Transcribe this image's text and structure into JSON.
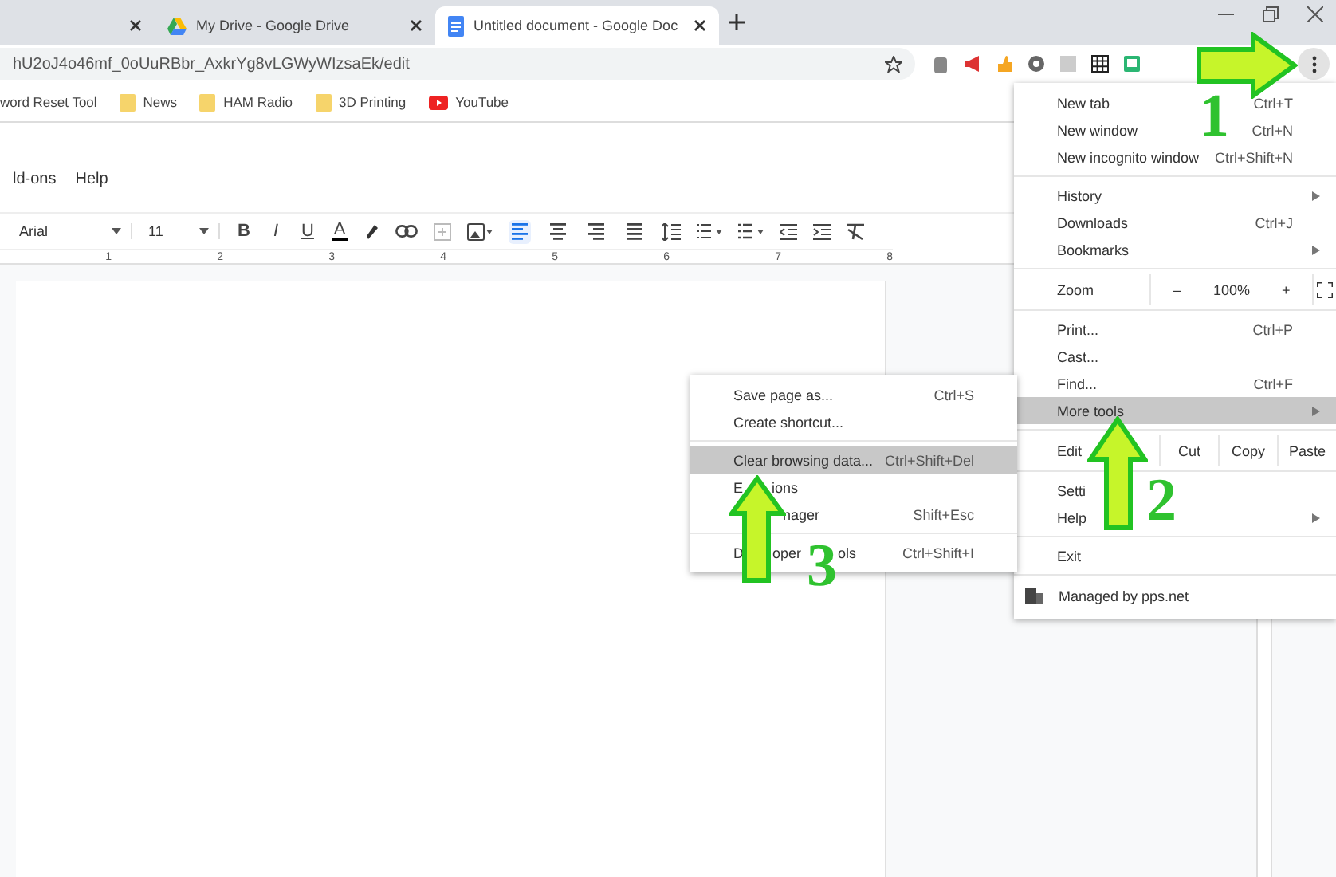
{
  "tabs": [
    {
      "selected": false
    },
    {
      "title": "My Drive - Google Drive",
      "selected": false
    },
    {
      "title": "Untitled document - Google Doc",
      "selected": true
    }
  ],
  "address": "hU2oJ4o46mf_0oUuRBbr_AxkrYg8vLGWyWIzsaEk/edit",
  "bookmarks": [
    {
      "label": "word Reset Tool",
      "kind": "plain"
    },
    {
      "label": "News",
      "kind": "folder"
    },
    {
      "label": "HAM Radio",
      "kind": "folder"
    },
    {
      "label": "3D Printing",
      "kind": "folder"
    },
    {
      "label": "YouTube",
      "kind": "video"
    }
  ],
  "docs_menu": [
    "ld-ons",
    "Help"
  ],
  "toolbar": {
    "font": "Arial",
    "size": "11",
    "format": [
      "B",
      "I",
      "U",
      "A"
    ],
    "alignment": [
      {
        "selected": true
      },
      {
        "selected": false
      },
      {
        "selected": false
      },
      {
        "selected": false
      }
    ]
  },
  "ruler": [
    "1",
    "2",
    "3",
    "4",
    "5",
    "6",
    "7",
    "8"
  ],
  "menu": [
    {
      "kind": "item",
      "label": "New tab",
      "shortcut": "Ctrl+T",
      "submenu": false,
      "selected": false
    },
    {
      "kind": "item",
      "label": "New window",
      "shortcut": "Ctrl+N",
      "submenu": false,
      "selected": false
    },
    {
      "kind": "item",
      "label": "New incognito window",
      "shortcut": "Ctrl+Shift+N",
      "submenu": false,
      "selected": false
    },
    {
      "kind": "divider"
    },
    {
      "kind": "item",
      "label": "History",
      "submenu": true,
      "selected": false
    },
    {
      "kind": "item",
      "label": "Downloads",
      "shortcut": "Ctrl+J",
      "submenu": false,
      "selected": false
    },
    {
      "kind": "item",
      "label": "Bookmarks",
      "submenu": true,
      "selected": false
    },
    {
      "kind": "divider"
    },
    {
      "kind": "zoom",
      "label": "Zoom",
      "minus": "–",
      "value": "100%",
      "plus": "+"
    },
    {
      "kind": "divider"
    },
    {
      "kind": "item",
      "label": "Print...",
      "shortcut": "Ctrl+P",
      "submenu": false,
      "selected": false
    },
    {
      "kind": "item",
      "label": "Cast...",
      "submenu": false,
      "selected": false
    },
    {
      "kind": "item",
      "label": "Find...",
      "shortcut": "Ctrl+F",
      "submenu": false,
      "selected": false
    },
    {
      "kind": "item",
      "label": "More tools",
      "submenu": true,
      "selected": true
    },
    {
      "kind": "divider"
    },
    {
      "kind": "edit",
      "label": "Edit",
      "actions": [
        "Cut",
        "Copy",
        "Paste"
      ]
    },
    {
      "kind": "divider"
    },
    {
      "kind": "item",
      "label": "Setti",
      "submenu": false,
      "selected": false
    },
    {
      "kind": "item",
      "label": "Help",
      "submenu": true,
      "selected": false
    },
    {
      "kind": "divider"
    },
    {
      "kind": "item",
      "label": "Exit",
      "submenu": false,
      "selected": false
    },
    {
      "kind": "divider"
    },
    {
      "kind": "managed",
      "label": "Managed by pps.net"
    }
  ],
  "submenu": [
    {
      "kind": "item",
      "fragments": [
        "Save page as..."
      ],
      "shortcut": "Ctrl+S",
      "selected": false
    },
    {
      "kind": "item",
      "fragments": [
        "Create shortcut..."
      ],
      "selected": false
    },
    {
      "kind": "divider"
    },
    {
      "kind": "item",
      "fragments": [
        "Clear browsing data..."
      ],
      "shortcut": "Ctrl+Shift+Del",
      "selected": true
    },
    {
      "kind": "item",
      "fragments": [
        "E",
        "ions"
      ],
      "selected": false
    },
    {
      "kind": "item",
      "fragments": [
        "nager"
      ],
      "starts_hidden": true,
      "shortcut": "Shift+Esc",
      "selected": false
    },
    {
      "kind": "divider"
    },
    {
      "kind": "item",
      "fragments": [
        "D",
        "oper",
        "ols"
      ],
      "shortcut": "Ctrl+Shift+I",
      "selected": false
    }
  ],
  "annotations": [
    {
      "number": "1"
    },
    {
      "number": "2"
    },
    {
      "number": "3"
    }
  ]
}
